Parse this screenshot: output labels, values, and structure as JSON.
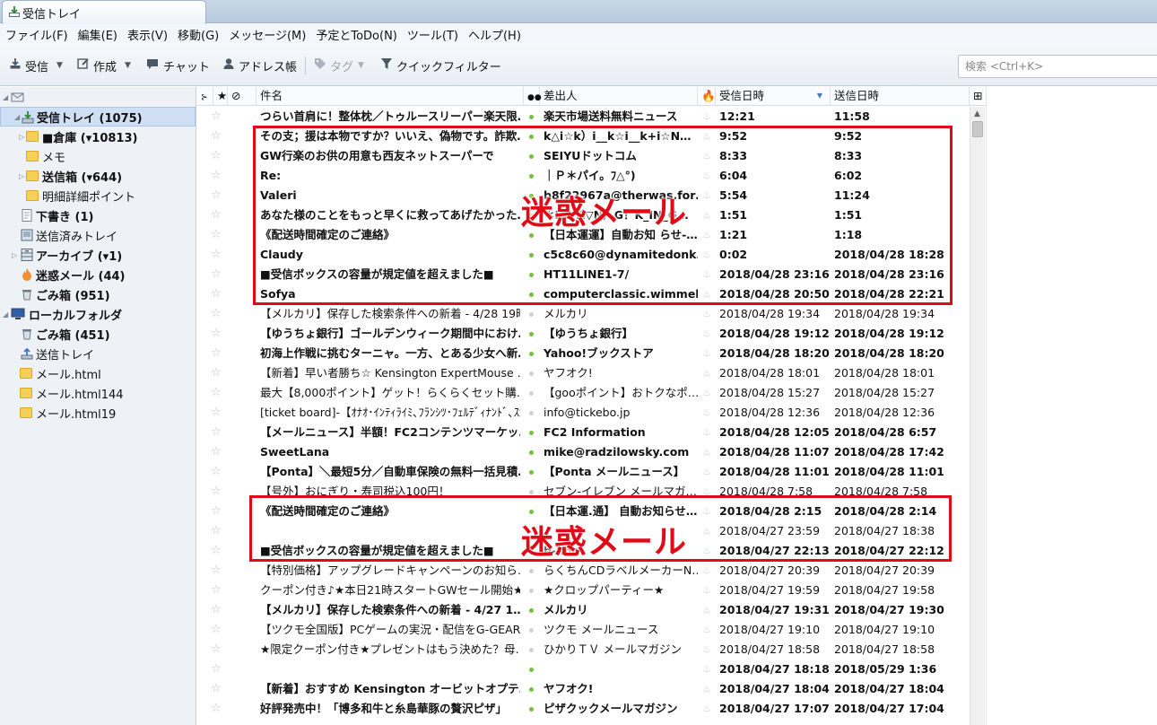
{
  "window": {
    "tab_title": "受信トレイ"
  },
  "menu": [
    "ファイル(F)",
    "編集(E)",
    "表示(V)",
    "移動(G)",
    "メッセージ(M)",
    "予定とToDo(N)",
    "ツール(T)",
    "ヘルプ(H)"
  ],
  "toolbar": {
    "get_mail": "受信",
    "write": "作成",
    "chat": "チャット",
    "address_book": "アドレス帳",
    "tag": "タグ",
    "quick_filter": "クイックフィルター"
  },
  "search": {
    "placeholder": "検索 <Ctrl+K>"
  },
  "folders": [
    {
      "label": "受信トレイ (1075)",
      "icon": "inbox-icon",
      "bold": true,
      "selected": true
    },
    {
      "label": "■倉庫 (▾10813)",
      "icon": "folder-icon",
      "bold": true
    },
    {
      "label": "メモ",
      "icon": "folder-icon",
      "bold": false
    },
    {
      "label": "送信箱 (▾644)",
      "icon": "folder-icon",
      "bold": true
    },
    {
      "label": "明細詳細ポイント",
      "icon": "folder-icon",
      "bold": false
    },
    {
      "label": "下書き (1)",
      "icon": "drafts-icon",
      "bold": true
    },
    {
      "label": "送信済みトレイ",
      "icon": "sent-icon",
      "bold": false
    },
    {
      "label": "アーカイブ (▾1)",
      "icon": "archive-icon",
      "bold": true
    },
    {
      "label": "迷惑メール (44)",
      "icon": "junk-icon",
      "bold": true
    },
    {
      "label": "ごみ箱 (951)",
      "icon": "trash-icon",
      "bold": true
    },
    {
      "label": "ローカルフォルダ",
      "icon": "local-folders-icon",
      "bold": true
    },
    {
      "label": "ごみ箱 (451)",
      "icon": "trash-icon",
      "bold": true
    },
    {
      "label": "送信トレイ",
      "icon": "outbox-icon",
      "bold": false
    },
    {
      "label": "メール.html",
      "icon": "folder-icon",
      "bold": false
    },
    {
      "label": "メール.html144",
      "icon": "folder-icon",
      "bold": false
    },
    {
      "label": "メール.html19",
      "icon": "folder-icon",
      "bold": false
    }
  ],
  "columns": {
    "subject": "件名",
    "from": "差出人",
    "received": "受信日時",
    "sent": "送信日時"
  },
  "messages": [
    {
      "subject": "つらい首肩に！整体枕／トゥルースリーパー楽天限…",
      "from": "楽天市場送料無料ニュース",
      "received": "12:21",
      "sent": "11:58",
      "unread": true
    },
    {
      "subject": "その支；援は本物ですか？いいえ、偽物です。詐欺…",
      "from": "k△i☆k）i__k☆i__k+i☆N…",
      "received": "9:52",
      "sent": "9:52",
      "unread": true
    },
    {
      "subject": "GW行楽のお供の用意も西友ネットスーパーで",
      "from": "SEIYUドットコム",
      "received": "8:33",
      "sent": "8:33",
      "unread": true
    },
    {
      "subject": "Re:",
      "from": "｜Ｐ＊パイ。ﾌ△°)",
      "received": "6:04",
      "sent": "6:02",
      "unread": true
    },
    {
      "subject": "Valeri",
      "from": "b8f22967a@therwas.for…",
      "received": "5:54",
      "sent": "11:24",
      "unread": true
    },
    {
      "subject": "あなた様のことをもっと早くに救ってあげたかった…",
      "from": "＊KI▽A▽N）G！K_IN_G…",
      "received": "1:51",
      "sent": "1:51",
      "unread": true
    },
    {
      "subject": "《配送時間確定のご連絡》",
      "from": "【日本運運】自動お知 らせ-…",
      "received": "1:21",
      "sent": "1:18",
      "unread": true
    },
    {
      "subject": "Claudy",
      "from": "c5c8c60@dynamitedonk…",
      "received": "0:02",
      "sent": "2018/04/28 18:28",
      "unread": true
    },
    {
      "subject": "■受信ボックスの容量が規定値を超えました■",
      "from": "HT11LINE1-7/",
      "received": "2018/04/28 23:16",
      "sent": "2018/04/28 23:16",
      "unread": true
    },
    {
      "subject": "Sofya",
      "from": "computerclassic.wimmel…",
      "received": "2018/04/28 20:50",
      "sent": "2018/04/28 22:21",
      "unread": true
    },
    {
      "subject": "【メルカリ】保存した検索条件への新着 - 4/28 19時",
      "from": "メルカリ",
      "received": "2018/04/28 19:34",
      "sent": "2018/04/28 19:34",
      "unread": false
    },
    {
      "subject": "【ゆうちょ銀行】ゴールデンウィーク期間中におけ…",
      "from": "【ゆうちょ銀行】",
      "received": "2018/04/28 19:12",
      "sent": "2018/04/28 19:12",
      "unread": true
    },
    {
      "subject": "初海上作戦に挑むターニャ。一方、とある少女へ新…",
      "from": "Yahoo!ブックストア",
      "received": "2018/04/28 18:20",
      "sent": "2018/04/28 18:20",
      "unread": true
    },
    {
      "subject": "【新着】早い者勝ち☆ Kensington ExpertMouse …",
      "from": "ヤフオク!",
      "received": "2018/04/28 18:01",
      "sent": "2018/04/28 18:01",
      "unread": false
    },
    {
      "subject": "最大【8,000ポイント】ゲット！らくらくセット購…",
      "from": "【gooポイント】おトクなポ…",
      "received": "2018/04/28 15:27",
      "sent": "2018/04/28 15:27",
      "unread": false
    },
    {
      "subject": "[ticket board]-【ｵﾅｵ･ｲﾝﾃｨﾗｲﾐ､ﾌﾗﾝｼﾂ･ﾌｪﾙﾃﾞｨﾅﾝﾄﾞ､ｽｶ…",
      "from": "info@tickebo.jp",
      "received": "2018/04/28 12:36",
      "sent": "2018/04/28 12:36",
      "unread": false
    },
    {
      "subject": "【メールニュース】半額！FC2コンテンツマーケッ…",
      "from": "FC2 Information",
      "received": "2018/04/28 12:05",
      "sent": "2018/04/28 6:57",
      "unread": true
    },
    {
      "subject": "SweetLana",
      "from": "mike@radzilowsky.com",
      "received": "2018/04/28 11:07",
      "sent": "2018/04/28 17:42",
      "unread": true
    },
    {
      "subject": "【Ponta】＼最短5分／自動車保険の無料一括見積…",
      "from": "【Ponta メールニュース】",
      "received": "2018/04/28 11:01",
      "sent": "2018/04/28 11:01",
      "unread": true
    },
    {
      "subject": "【号外】おにぎり・寿司税込100円！",
      "from": "セブン-イレブン メールマガ…",
      "received": "2018/04/28 7:58",
      "sent": "2018/04/28 7:58",
      "unread": false
    },
    {
      "subject": "《配送時間確定のご連絡》",
      "from": "【日本運.通】 自動お知らせ…",
      "received": "2018/04/28 2:15",
      "sent": "2018/04/28 2:14",
      "unread": true
    },
    {
      "subject": "",
      "from": "",
      "received": "2018/04/27 23:59",
      "sent": "2018/04/27 18:38",
      "unread": false
    },
    {
      "subject": "■受信ボックスの容量が規定値を超えました■",
      "from": "h-line",
      "received": "2018/04/27 22:13",
      "sent": "2018/04/27 22:12",
      "unread": true
    },
    {
      "subject": "【特別価格】アップグレードキャンペーンのお知ら…",
      "from": "らくちんCDラベルメーカーN…",
      "received": "2018/04/27 20:39",
      "sent": "2018/04/27 20:39",
      "unread": false
    },
    {
      "subject": "クーポン付き♪★本日21時スタートGWセール開始★",
      "from": "★クロップパーティー★",
      "received": "2018/04/27 19:59",
      "sent": "2018/04/27 19:58",
      "unread": false
    },
    {
      "subject": "【メルカリ】保存した検索条件への新着 - 4/27 1…",
      "from": "メルカリ",
      "received": "2018/04/27 19:31",
      "sent": "2018/04/27 19:30",
      "unread": true
    },
    {
      "subject": "【ツクモ全国版】PCゲームの実況・配信をG-GEAR…",
      "from": "ツクモ メールニュース",
      "received": "2018/04/27 19:10",
      "sent": "2018/04/27 19:10",
      "unread": false
    },
    {
      "subject": "★限定クーポン付き★プレゼントはもう決めた？母…",
      "from": "ひかりＴＶ メールマガジン",
      "received": "2018/04/27 18:58",
      "sent": "2018/04/27 18:58",
      "unread": false
    },
    {
      "subject": "",
      "from": "",
      "received": "2018/04/27 18:18",
      "sent": "2018/05/29 1:36",
      "unread": true
    },
    {
      "subject": "【新着】おすすめ Kensington オービットオプテ…",
      "from": "ヤフオク!",
      "received": "2018/04/27 18:04",
      "sent": "2018/04/27 18:04",
      "unread": true
    },
    {
      "subject": "好評発売中！「博多和牛と糸島華豚の贅沢ピザ」",
      "from": "ピザクックメールマガジン",
      "received": "2018/04/27 17:07",
      "sent": "2018/04/27 17:04",
      "unread": true
    }
  ],
  "annotations": [
    {
      "label": "迷惑メール"
    },
    {
      "label": "迷惑メール"
    }
  ]
}
